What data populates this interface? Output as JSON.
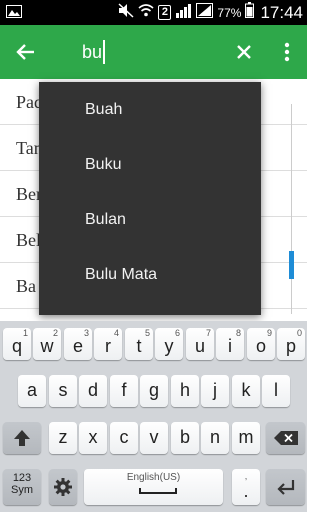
{
  "status_bar": {
    "sim_badge": "2",
    "battery_percent": "77%",
    "time": "17:44",
    "icons": [
      "image-icon",
      "mute-icon",
      "wifi-icon",
      "signal-icon",
      "battery-icon"
    ]
  },
  "toolbar": {
    "back_icon": "arrow-left-icon",
    "search_value": "bu",
    "clear_icon": "close-icon",
    "more_icon": "more-vert-icon",
    "color": "#2ea84a"
  },
  "list": {
    "items": [
      "Pad",
      "Tan",
      "Ber",
      "Bel",
      "Ba"
    ]
  },
  "suggestions": [
    "Buah",
    "Buku",
    "Bulan",
    "Bulu Mata"
  ],
  "keyboard": {
    "row1": [
      {
        "main": "q",
        "sub": "1"
      },
      {
        "main": "w",
        "sub": "2"
      },
      {
        "main": "e",
        "sub": "3"
      },
      {
        "main": "r",
        "sub": "4"
      },
      {
        "main": "t",
        "sub": "5"
      },
      {
        "main": "y",
        "sub": "6"
      },
      {
        "main": "u",
        "sub": "7"
      },
      {
        "main": "i",
        "sub": "8"
      },
      {
        "main": "o",
        "sub": "9"
      },
      {
        "main": "p",
        "sub": "0"
      }
    ],
    "row2": [
      "a",
      "s",
      "d",
      "f",
      "g",
      "h",
      "j",
      "k",
      "l"
    ],
    "row3": [
      "z",
      "x",
      "c",
      "v",
      "b",
      "n",
      "m"
    ],
    "symbols_label_1": "123",
    "symbols_label_2": "Sym",
    "space_label": "English(US)",
    "period": ".",
    "period_sub": ",",
    "settings_icon": "gear-icon",
    "shift_icon": "shift-icon",
    "backspace_icon": "backspace-icon",
    "enter_icon": "enter-icon"
  }
}
